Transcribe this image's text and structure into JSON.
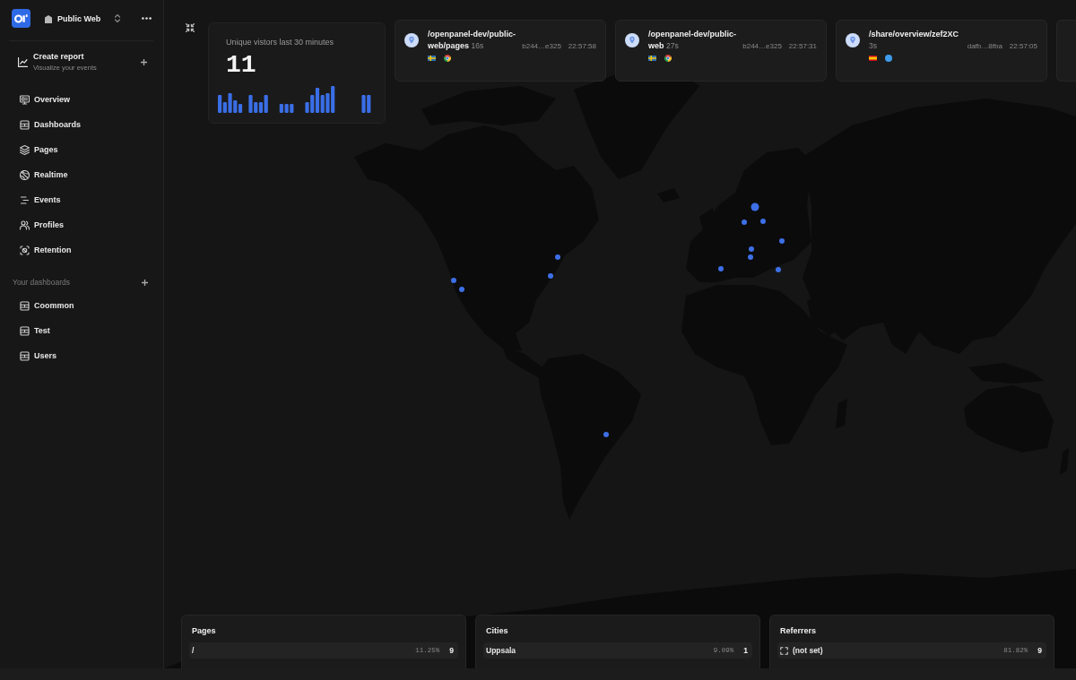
{
  "sidebar": {
    "project": "Public Web",
    "create_report": {
      "title": "Create report",
      "subtitle": "Visualize your events"
    },
    "nav": [
      {
        "label": "Overview"
      },
      {
        "label": "Dashboards"
      },
      {
        "label": "Pages"
      },
      {
        "label": "Realtime"
      },
      {
        "label": "Events"
      },
      {
        "label": "Profiles"
      },
      {
        "label": "Retention"
      }
    ],
    "dashboards_heading": "Your dashboards",
    "dashboards": [
      {
        "label": "Coommon"
      },
      {
        "label": "Test"
      },
      {
        "label": "Users"
      }
    ]
  },
  "visitors": {
    "title": "Unique vistors last 30 minutes",
    "count": "11"
  },
  "events": [
    {
      "path": "/openpanel-dev/public-web/pages",
      "duration": "16s",
      "profile": "b244…e325",
      "time": "22:57:58"
    },
    {
      "path": "/openpanel-dev/public-web",
      "duration": "27s",
      "profile": "b244…e325",
      "time": "22:57:31"
    },
    {
      "path": "/share/overview/zef2XC",
      "duration": "3s",
      "profile": "dafb…8fba",
      "time": "22:57:05"
    }
  ],
  "lists": [
    {
      "title": "Pages",
      "kind": "plain",
      "rows": [
        {
          "label": "/",
          "share": "11.25%",
          "count": "9"
        }
      ]
    },
    {
      "title": "Cities",
      "kind": "plain",
      "rows": [
        {
          "label": "Uppsala",
          "share": "9.09%",
          "count": "1"
        }
      ]
    },
    {
      "title": "Referrers",
      "kind": "favicon",
      "rows": [
        {
          "label": "(not set)",
          "share": "81.82%",
          "count": "9"
        }
      ]
    }
  ]
}
